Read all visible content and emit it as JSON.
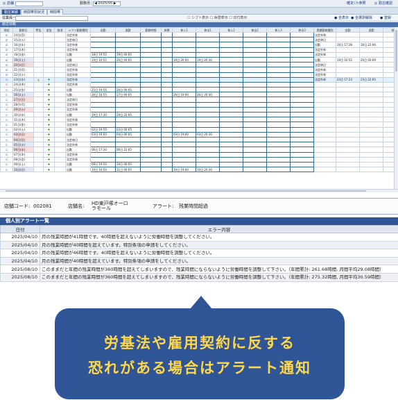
{
  "topbar": {
    "home_label": "◎ 店舗",
    "period_label": "勤務月：",
    "period_value": "◀ 2025/05 ▶",
    "right_links": [
      "確定ｼﾌﾄ参照",
      "◎ 勤怠確認"
    ]
  },
  "tabs": [
    "勤怠実績",
    "時間帯別状況",
    "時間帯"
  ],
  "filter": {
    "label": "従業員一覧",
    "middle_text": "☐ シフト表示 ☐ 休憩表示 ☐ 日付表示",
    "right_links": [
      "● 全表示",
      "● 全選択解除",
      "● 登録"
    ]
  },
  "section_title": "勤怠情報",
  "grid": {
    "headers": [
      "承認",
      "勤務日",
      "警告",
      "追加",
      "取消",
      "シフト勤務種別",
      "出勤",
      "退勤",
      "勤務時間",
      "休憩",
      "休入1",
      "休出1",
      "休入2",
      "休出2",
      "休入3",
      "休出3",
      "実績勤務種別",
      "出勤",
      "退勤",
      "休入",
      "休出"
    ],
    "rows": [
      {
        "chk": "☑",
        "date": "14日(月)",
        "warn": "",
        "plus": "",
        "shift": "法定外休",
        "in": "",
        "out": "",
        "cls": "",
        "r_kind": "法定外休",
        "r_in": "",
        "r_out": "",
        "r_b1": "",
        "r_b2": ""
      },
      {
        "chk": "☑",
        "date": "15日(火)",
        "warn": "",
        "plus": "",
        "shift": "法定休日",
        "in": "",
        "out": "",
        "cls": "",
        "r_kind": "法定休日",
        "r_in": "",
        "r_out": "",
        "r_b1": "",
        "r_b2": ""
      },
      {
        "chk": "☑",
        "date": "16日(水)",
        "warn": "",
        "plus": "",
        "shift": "法定外休",
        "in": "",
        "out": "",
        "cls": "",
        "r_kind": "出勤",
        "r_in": "16日 17:28",
        "r_out": "16日 22:06",
        "r_b1": "",
        "r_b2": ""
      },
      {
        "chk": "☑",
        "date": "17日(木)",
        "warn": "",
        "plus": "",
        "shift": "法定外休",
        "in": "",
        "out": "",
        "cls": "",
        "r_kind": "法定外休",
        "r_in": "",
        "r_out": "",
        "r_b1": "",
        "r_b2": ""
      },
      {
        "chk": "☑",
        "date": "18日(金)",
        "warn": "",
        "plus": "",
        "shift": "出勤",
        "in": "18日 19:55",
        "out": "19日 00:05",
        "cls": "",
        "r_kind": "法定外休",
        "r_in": "",
        "r_out": "",
        "r_b1": "",
        "r_b2": ""
      },
      {
        "chk": "☑",
        "date": "19日(土)",
        "warn": "",
        "plus": "",
        "shift": "出勤",
        "in": "19日 16:55",
        "out": "20日 00:05",
        "cls": "sat",
        "r_kind": "出勤",
        "r_in": "19日 16:55",
        "r_out": "20日 00:09",
        "r_b1": "19日 20:00",
        "r_b2": "19日 20:30"
      },
      {
        "chk": "☑",
        "date": "20日(日)",
        "warn": "",
        "plus": "",
        "shift": "法定休日",
        "in": "",
        "out": "",
        "cls": "sun",
        "r_kind": "法定休日",
        "r_in": "",
        "r_out": "",
        "r_b1": "",
        "r_b2": ""
      },
      {
        "chk": "☑",
        "date": "21日(月)",
        "warn": "",
        "plus": "",
        "shift": "法定外休",
        "in": "",
        "out": "",
        "cls": "",
        "r_kind": "法定外休",
        "r_in": "",
        "r_out": "",
        "r_b1": "",
        "r_b2": ""
      },
      {
        "chk": "☑",
        "date": "22日(火)",
        "warn": "",
        "plus": "",
        "shift": "法定外休",
        "in": "",
        "out": "",
        "cls": "",
        "r_kind": "法定外休",
        "r_in": "",
        "r_out": "",
        "r_b1": "",
        "r_b2": ""
      },
      {
        "chk": "☐",
        "date": "23日(水)",
        "warn": "▲",
        "plus": "✚",
        "shift": "法定外休",
        "in": "",
        "out": "",
        "cls": "hl",
        "r_kind": "法定外休",
        "r_in": "23日 17:23",
        "r_out": "23日 22:05",
        "r_b1": "",
        "r_b2": ""
      },
      {
        "chk": "☐",
        "date": "24日(木)",
        "warn": "",
        "plus": "✚",
        "shift": "法定外休",
        "in": "",
        "out": "",
        "cls": "",
        "r_kind": "",
        "r_in": "",
        "r_out": "",
        "r_b1": "",
        "r_b2": ""
      },
      {
        "chk": "☐",
        "date": "25日(金)",
        "warn": "",
        "plus": "✚",
        "shift": "出勤",
        "in": "25日 19:55",
        "out": "26日 00:05",
        "cls": "",
        "r_kind": "",
        "r_in": "",
        "r_out": "",
        "r_b1": "",
        "r_b2": ""
      },
      {
        "chk": "☐",
        "date": "26日(土)",
        "warn": "",
        "plus": "✚",
        "shift": "出勤",
        "in": "26日 16:55",
        "out": "27日 00:05",
        "cls": "sat",
        "r_kind": "",
        "r_in": "",
        "r_out": "",
        "r_b1": "26日 19:00",
        "r_b2": "26日 20:30"
      },
      {
        "chk": "☐",
        "date": "27日(日)",
        "warn": "",
        "plus": "✚",
        "shift": "法定休日",
        "in": "",
        "out": "",
        "cls": "sun",
        "r_kind": "",
        "r_in": "",
        "r_out": "",
        "r_b1": "",
        "r_b2": ""
      },
      {
        "chk": "☐",
        "date": "28日(月)",
        "warn": "",
        "plus": "✚",
        "shift": "法定外休",
        "in": "",
        "out": "",
        "cls": "",
        "r_kind": "",
        "r_in": "",
        "r_out": "",
        "r_b1": "",
        "r_b2": ""
      },
      {
        "chk": "☐",
        "date": "29日(火)",
        "warn": "",
        "plus": "✚",
        "shift": "法定外休",
        "in": "",
        "out": "",
        "cls": "hol",
        "r_kind": "",
        "r_in": "",
        "r_out": "",
        "r_b1": "",
        "r_b2": ""
      },
      {
        "chk": "☐",
        "date": "30日(水)",
        "warn": "",
        "plus": "✚",
        "shift": "出勤",
        "in": "29日 17:30",
        "out": "29日 22:05",
        "cls": "",
        "r_kind": "",
        "r_in": "",
        "r_out": "",
        "r_b1": "",
        "r_b2": ""
      },
      {
        "chk": "☐",
        "date": "31日(木)",
        "warn": "",
        "plus": "✚",
        "shift": "法定外休",
        "in": "",
        "out": "",
        "cls": "",
        "r_kind": "",
        "r_in": "",
        "r_out": "",
        "r_b1": "",
        "r_b2": ""
      },
      {
        "chk": "☐",
        "date": "01日(金)",
        "warn": "",
        "plus": "✚",
        "shift": "法定外休",
        "in": "",
        "out": "",
        "cls": "",
        "r_kind": "",
        "r_in": "",
        "r_out": "",
        "r_b1": "",
        "r_b2": ""
      },
      {
        "chk": "☐",
        "date": "02日(土)",
        "warn": "",
        "plus": "✚",
        "shift": "出勤",
        "in": "02日 19:55",
        "out": "03日 00:05",
        "cls": "",
        "r_kind": "",
        "r_in": "",
        "r_out": "",
        "r_b1": "",
        "r_b2": ""
      },
      {
        "chk": "☐",
        "date": "03日(日)",
        "warn": "",
        "plus": "✚",
        "shift": "出勤",
        "in": "03日 16:55",
        "out": "04日 00:05",
        "cls": "sun",
        "r_kind": "",
        "r_in": "",
        "r_out": "",
        "r_b1": "03日 19:00",
        "r_b2": "03日 20:30"
      },
      {
        "chk": "☐",
        "date": "04日(月)",
        "warn": "",
        "plus": "✚",
        "shift": "法定休日",
        "in": "",
        "out": "",
        "cls": "sun",
        "r_kind": "",
        "r_in": "",
        "r_out": "",
        "r_b1": "",
        "r_b2": ""
      },
      {
        "chk": "☐",
        "date": "05日(火)",
        "warn": "",
        "plus": "✚",
        "shift": "法定外休",
        "in": "",
        "out": "",
        "cls": "sat",
        "r_kind": "",
        "r_in": "",
        "r_out": "",
        "r_b1": "",
        "r_b2": ""
      },
      {
        "chk": "☐",
        "date": "06日(水)",
        "warn": "",
        "plus": "✚",
        "shift": "出勤",
        "in": "06日 17:30",
        "out": "06日 22:05",
        "cls": "sun",
        "r_kind": "",
        "r_in": "",
        "r_out": "",
        "r_b1": "",
        "r_b2": ""
      },
      {
        "chk": "☐",
        "date": "07日(木)",
        "warn": "",
        "plus": "✚",
        "shift": "法定外休",
        "in": "",
        "out": "",
        "cls": "",
        "r_kind": "",
        "r_in": "",
        "r_out": "",
        "r_b1": "",
        "r_b2": ""
      },
      {
        "chk": "☐",
        "date": "08日(金)",
        "warn": "",
        "plus": "✚",
        "shift": "法定外休",
        "in": "",
        "out": "",
        "cls": "",
        "r_kind": "",
        "r_in": "",
        "r_out": "",
        "r_b1": "",
        "r_b2": ""
      },
      {
        "chk": "☐",
        "date": "09日(土)",
        "warn": "",
        "plus": "✚",
        "shift": "出勤",
        "in": "09日 19:55",
        "out": "10日 00:05",
        "cls": "",
        "r_kind": "",
        "r_in": "",
        "r_out": "",
        "r_b1": "",
        "r_b2": ""
      },
      {
        "chk": "☐",
        "date": "10日(日)",
        "warn": "",
        "plus": "✚",
        "shift": "出勤",
        "in": "10日 16:55",
        "out": "11日 00:05",
        "cls": "sat",
        "r_kind": "",
        "r_in": "",
        "r_out": "",
        "r_b1": "10日 19:00",
        "r_b2": "10日 20:30"
      }
    ]
  },
  "store": {
    "code_label": "店舗コード:",
    "code_value": "002081",
    "name_label": "店舗名:",
    "name_value": "HD東戸塚オーロラモール",
    "alert_label": "アラート:",
    "alert_value": "残業時間超過"
  },
  "alerts": {
    "title": "個人別アラート一覧",
    "col_date": "日付",
    "col_content": "エラー内容",
    "rows": [
      {
        "date": "2025/04/10",
        "text": "月の残業時間が41時間です。40時間を超えないように労働時間を調整してください。"
      },
      {
        "date": "2025/04/10",
        "text": "月の残業時間が40時間を超えています。特別条項の申請をしてください。"
      },
      {
        "date": "2025/04/10",
        "text": "月の残業時間が46時間です。40時間を超えないように労働時間を調整してください。"
      },
      {
        "date": "2025/04/10",
        "text": "月の残業時間が40時間を超えています。特別条項の申請をしてください。"
      },
      {
        "date": "2025/08/10",
        "text": "このままだと年間の残業時間が360時間を超えてしまいますので、残業時間にならないように労働時間を調整して下さい。（年間累計: 261.68時間, 月間平均29.08時間）"
      },
      {
        "date": "2025/08/10",
        "text": "このままだと年間の残業時間が360時間を超えてしまいますので、残業時間にならないように労働時間を調整して下さい。（年間累計: 275.32時間, 月間平均30.59時間）"
      }
    ]
  },
  "callout": {
    "line1": "労基法や雇用契約に反する",
    "line2": "恐れがある場合はアラート通知"
  },
  "colors": {
    "header_blue": "#2f5597",
    "callout_text": "#ffd84a",
    "plus_green": "#3a9a2a",
    "warn_yellow": "#d4a600"
  }
}
